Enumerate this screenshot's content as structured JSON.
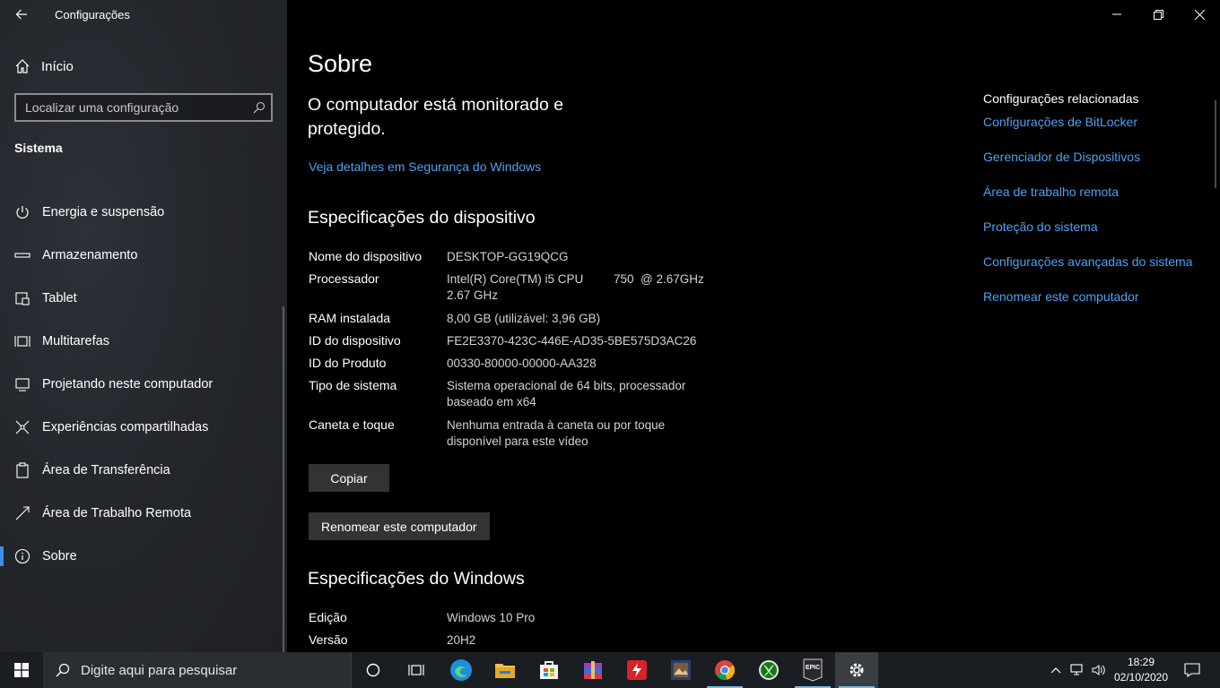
{
  "window": {
    "app_title": "Configurações"
  },
  "sidebar": {
    "home_label": "Início",
    "search_placeholder": "Localizar uma configuração",
    "section_label": "Sistema",
    "items": [
      {
        "label": "Energia e suspensão",
        "icon": "power-icon"
      },
      {
        "label": "Armazenamento",
        "icon": "storage-icon"
      },
      {
        "label": "Tablet",
        "icon": "tablet-icon"
      },
      {
        "label": "Multitarefas",
        "icon": "multitasking-icon"
      },
      {
        "label": "Projetando neste computador",
        "icon": "projecting-icon"
      },
      {
        "label": "Experiências compartilhadas",
        "icon": "shared-experiences-icon"
      },
      {
        "label": "Área de Transferência",
        "icon": "clipboard-icon"
      },
      {
        "label": "Área de Trabalho Remota",
        "icon": "remote-desktop-icon"
      },
      {
        "label": "Sobre",
        "icon": "info-icon",
        "active": true
      }
    ]
  },
  "main": {
    "title": "Sobre",
    "protection_status": "O computador está monitorado e protegido.",
    "security_link": "Veja detalhes em Segurança do Windows",
    "device_specs": {
      "heading": "Especificações do dispositivo",
      "rows": [
        {
          "label": "Nome do dispositivo",
          "value": "DESKTOP-GG19QCG"
        },
        {
          "label": "Processador",
          "value": "Intel(R) Core(TM) i5 CPU         750  @ 2.67GHz   2.67 GHz"
        },
        {
          "label": "RAM instalada",
          "value": "8,00 GB (utilizável: 3,96 GB)"
        },
        {
          "label": "ID do dispositivo",
          "value": "FE2E3370-423C-446E-AD35-5BE575D3AC26"
        },
        {
          "label": "ID do Produto",
          "value": "00330-80000-00000-AA328"
        },
        {
          "label": "Tipo de sistema",
          "value": "Sistema operacional de 64 bits, processador baseado em x64"
        },
        {
          "label": "Caneta e toque",
          "value": "Nenhuma entrada à caneta ou por toque disponível para este vídeo"
        }
      ],
      "copy_button": "Copiar",
      "rename_button": "Renomear este computador"
    },
    "windows_specs": {
      "heading": "Especificações do Windows",
      "rows": [
        {
          "label": "Edição",
          "value": "Windows 10 Pro"
        },
        {
          "label": "Versão",
          "value": "20H2"
        }
      ]
    },
    "related": {
      "title": "Configurações relacionadas",
      "links": [
        "Configurações de BitLocker",
        "Gerenciador de Dispositivos",
        "Área de trabalho remota",
        "Proteção do sistema",
        "Configurações avançadas do sistema",
        "Renomear este computador"
      ]
    }
  },
  "taskbar": {
    "search_placeholder": "Digite aqui para pesquisar",
    "time": "18:29",
    "date": "02/10/2020",
    "accent": "#76b9ed"
  },
  "colors": {
    "link": "#4ea1f3",
    "active_indicator": "#3b8eea"
  }
}
